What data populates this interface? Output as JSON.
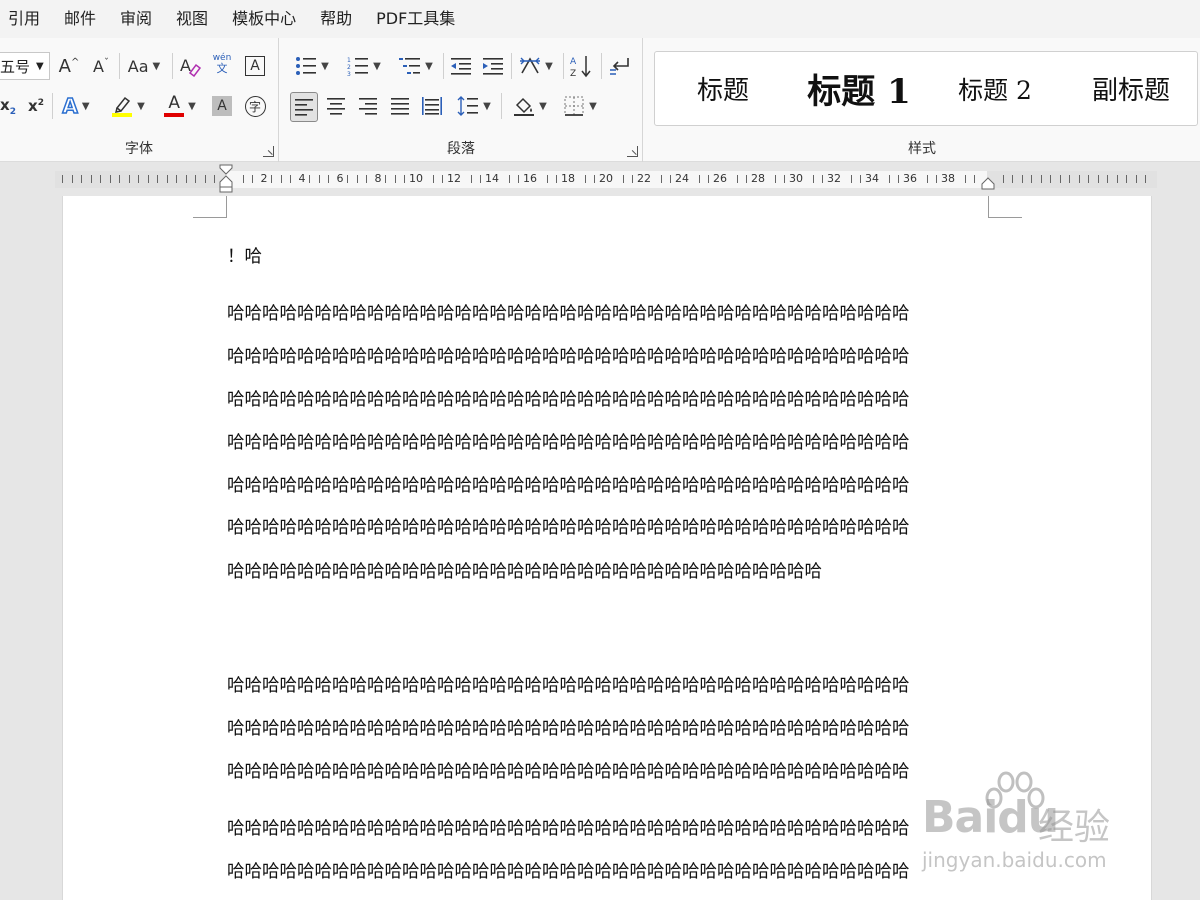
{
  "menu": [
    "引用",
    "邮件",
    "审阅",
    "视图",
    "模板中心",
    "帮助",
    "PDF工具集"
  ],
  "font_group": {
    "label": "字体",
    "font_size": "五号",
    "grow_glyph": "A",
    "shrink_glyph": "A",
    "change_case": "Aa",
    "phonetic_top": "wén",
    "phonetic_bottom": "文",
    "border_char": "A",
    "subscript": "x",
    "subscript_mark": "2",
    "superscript": "x",
    "superscript_mark": "2",
    "text_effect": "A",
    "font_color": "A",
    "char_shading": "A",
    "enclose_char": "字",
    "highlight_color": "#ffff00",
    "font_color_value": "#e00000"
  },
  "para_group": {
    "label": "段落"
  },
  "style_group": {
    "label": "样式",
    "styles": [
      "标题",
      "标题 1",
      "标题 2",
      "副标题"
    ]
  },
  "ruler": {
    "numbers": [
      "2",
      "4",
      "6",
      "8",
      "10",
      "12",
      "14",
      "16",
      "18",
      "20",
      "22",
      "24",
      "26",
      "28",
      "30",
      "32",
      "34",
      "36",
      "38"
    ]
  },
  "document": {
    "lines": [
      "！哈",
      "哈哈哈哈哈哈哈哈哈哈哈哈哈哈哈哈哈哈哈哈哈哈哈哈哈哈哈哈哈哈哈哈哈哈哈哈哈哈哈",
      "哈哈哈哈哈哈哈哈哈哈哈哈哈哈哈哈哈哈哈哈哈哈哈哈哈哈哈哈哈哈哈哈哈哈哈哈哈哈哈",
      "哈哈哈哈哈哈哈哈哈哈哈哈哈哈哈哈哈哈哈哈哈哈哈哈哈哈哈哈哈哈哈哈哈哈哈哈哈哈哈",
      "哈哈哈哈哈哈哈哈哈哈哈哈哈哈哈哈哈哈哈哈哈哈哈哈哈哈哈哈哈哈哈哈哈哈哈哈哈哈哈",
      "哈哈哈哈哈哈哈哈哈哈哈哈哈哈哈哈哈哈哈哈哈哈哈哈哈哈哈哈哈哈哈哈哈哈哈哈哈哈哈",
      "哈哈哈哈哈哈哈哈哈哈哈哈哈哈哈哈哈哈哈哈哈哈哈哈哈哈哈哈哈哈哈哈哈哈哈哈哈哈哈",
      "哈哈哈哈哈哈哈哈哈哈哈哈哈哈哈哈哈哈哈哈哈哈哈哈哈哈哈哈哈哈哈哈哈哈",
      "哈哈哈哈哈哈哈哈哈哈哈哈哈哈哈哈哈哈哈哈哈哈哈哈哈哈哈哈哈哈哈哈哈哈哈哈哈哈哈",
      "哈哈哈哈哈哈哈哈哈哈哈哈哈哈哈哈哈哈哈哈哈哈哈哈哈哈哈哈哈哈哈哈哈哈哈哈哈哈哈",
      "哈哈哈哈哈哈哈哈哈哈哈哈哈哈哈哈哈哈哈哈哈哈哈哈哈哈哈哈哈哈哈哈哈哈哈哈哈哈哈",
      "哈哈哈哈哈哈哈哈哈哈哈哈哈哈哈哈哈哈哈哈哈哈哈哈哈哈哈哈哈哈哈哈哈哈哈哈哈哈哈",
      "哈哈哈哈哈哈哈哈哈哈哈哈哈哈哈哈哈哈哈哈哈哈哈哈哈哈哈哈哈哈哈哈哈哈哈哈哈哈哈"
    ]
  },
  "watermark": {
    "brand": "Baidu",
    "cn": "经验",
    "url": "jingyan.baidu.com"
  }
}
